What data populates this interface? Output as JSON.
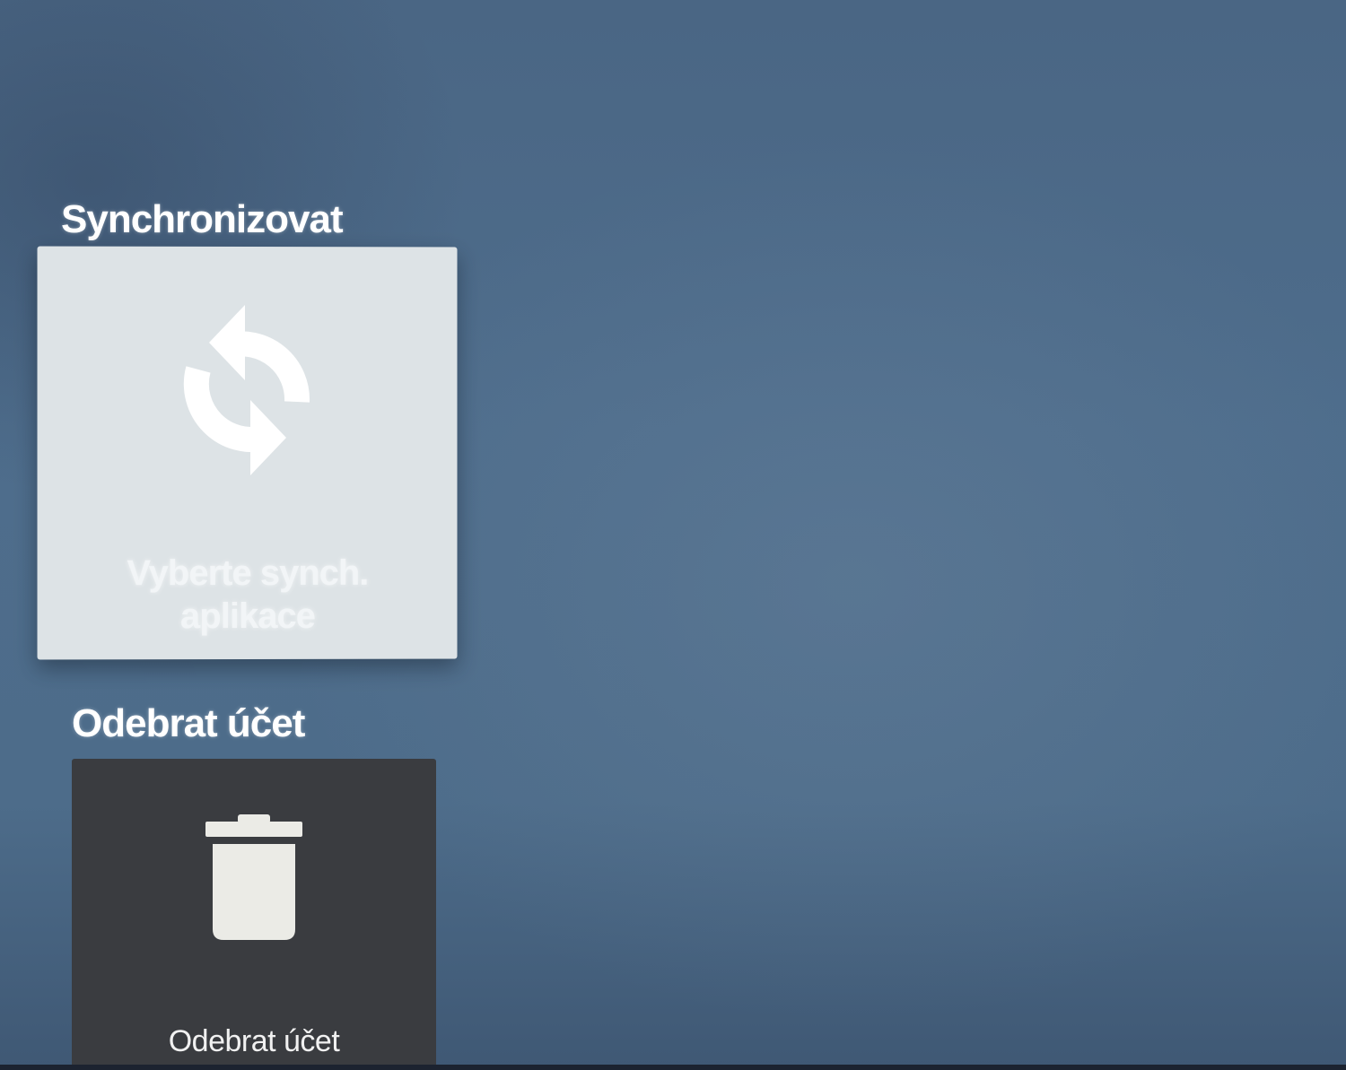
{
  "sections": [
    {
      "title": "Synchronizovat",
      "card": {
        "label": "Vyberte synch. aplikace",
        "icon": "sync-icon",
        "background": "#dde3e6",
        "focused": true
      }
    },
    {
      "title": "Odebrat účet",
      "card": {
        "label": "Odebrat účet",
        "icon": "trash-icon",
        "background": "#3a3c40",
        "focused": false
      }
    }
  ],
  "colors": {
    "background": "#4e6d8c",
    "title_text": "#ffffff"
  }
}
